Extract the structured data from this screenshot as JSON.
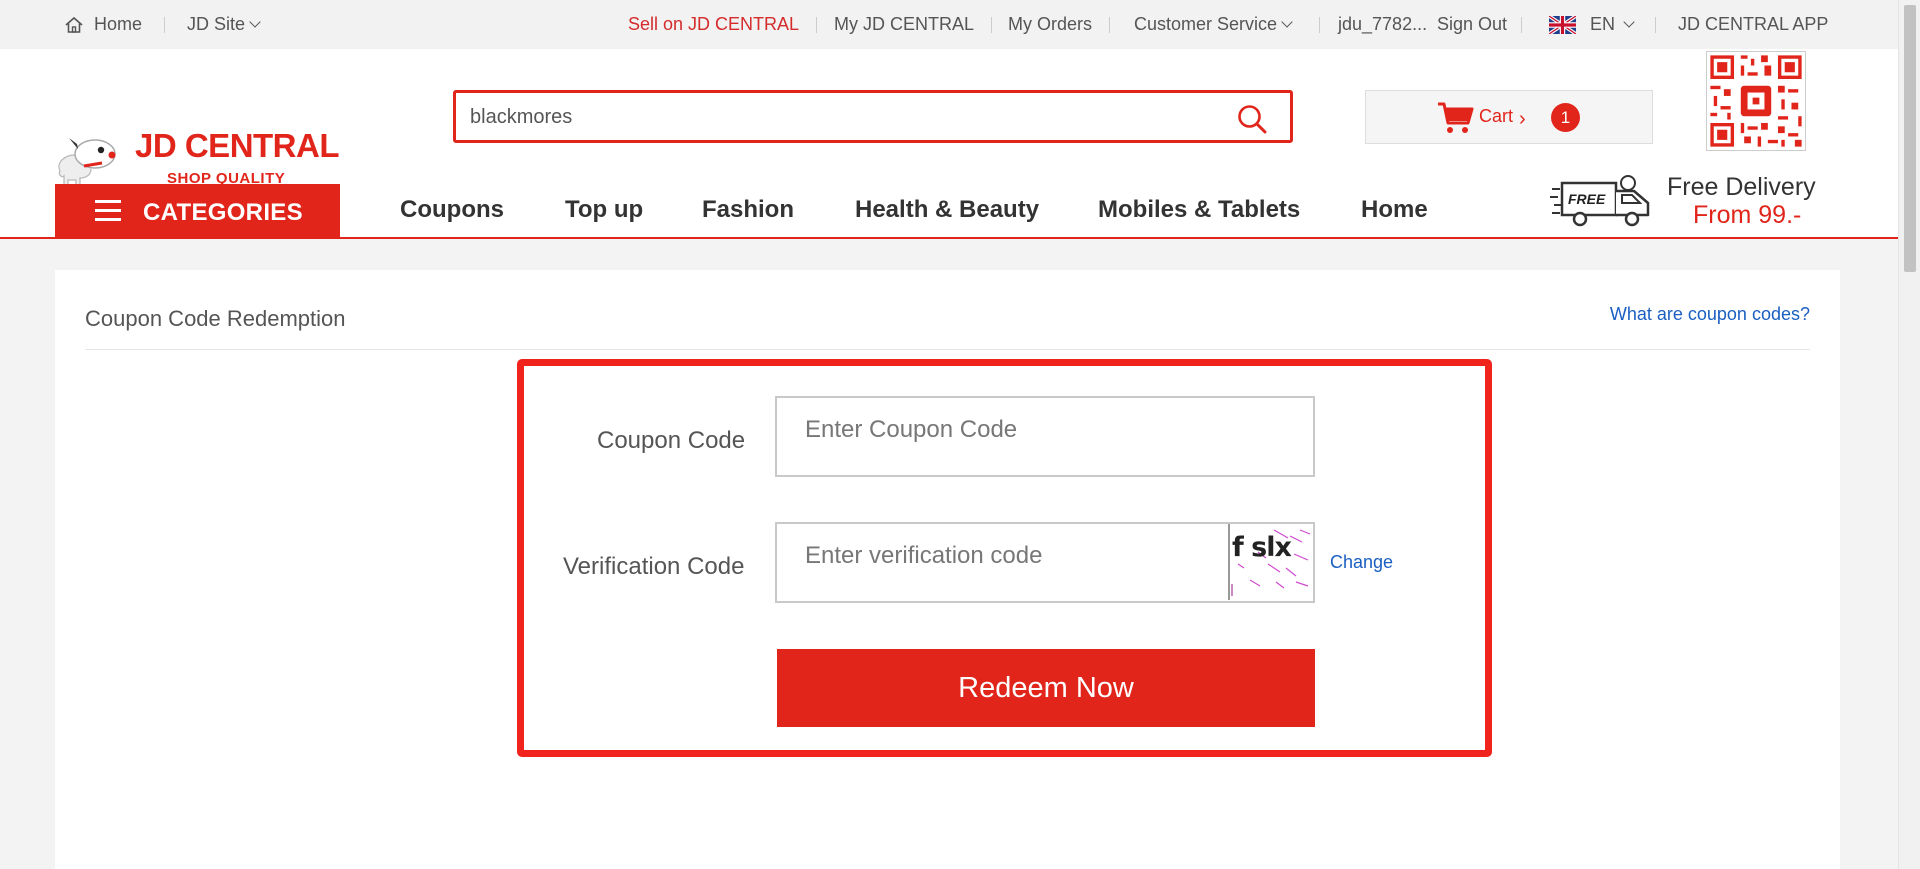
{
  "topbar": {
    "home": "Home",
    "site": "JD Site",
    "sell": "Sell on JD CENTRAL",
    "my_account": "My JD CENTRAL",
    "orders": "My Orders",
    "service": "Customer Service",
    "user": "jdu_7782...",
    "signout": "Sign Out",
    "lang": "EN",
    "app": "JD CENTRAL APP"
  },
  "logo": {
    "brand": "JD CENTRAL",
    "tagline": "SHOP QUALITY"
  },
  "search": {
    "value": "blackmores"
  },
  "cart": {
    "label": "Cart",
    "arrow": "›",
    "count": "1"
  },
  "categories_button": "CATEGORIES",
  "nav": [
    "Coupons",
    "Top up",
    "Fashion",
    "Health & Beauty",
    "Mobiles & Tablets",
    "Home"
  ],
  "promo": {
    "badge": "FREE",
    "line1": "Free Delivery",
    "line2": "From 99.-"
  },
  "page": {
    "title": "Coupon Code Redemption",
    "help_link": "What are coupon codes?"
  },
  "form": {
    "coupon_label": "Coupon Code",
    "coupon_placeholder": "Enter Coupon Code",
    "verify_label": "Verification Code",
    "verify_placeholder": "Enter verification code",
    "captcha_text": "f slx",
    "change_link": "Change",
    "redeem_button": "Redeem Now"
  },
  "colors": {
    "brand_red": "#e1251b",
    "link_blue": "#1a5fc1",
    "highlight_frame": "#f0231d"
  }
}
